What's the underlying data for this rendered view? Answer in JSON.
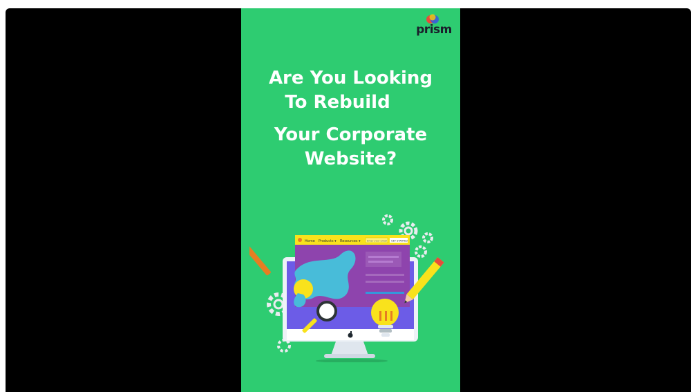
{
  "brand": {
    "name": "prism",
    "colors": {
      "background": "#2ecc71",
      "frame": "#000000",
      "headline": "#ffffff",
      "logo_text": "#1a1f2b"
    }
  },
  "headline": {
    "line1": "Are You Looking",
    "line2": "To Rebuild",
    "line3": "Your Corporate",
    "line4": "Website?"
  },
  "illustration": {
    "nav": {
      "home": "Home",
      "products": "Products ▾",
      "resources": "Resources ▾",
      "search": "Enter your email",
      "cta": "GET STARTED"
    },
    "icons": [
      "gear-icon",
      "pencil-icon",
      "paintbrush-icon",
      "magnifier-icon",
      "lightbulb-icon",
      "monitor-icon",
      "apple-logo-icon"
    ]
  }
}
